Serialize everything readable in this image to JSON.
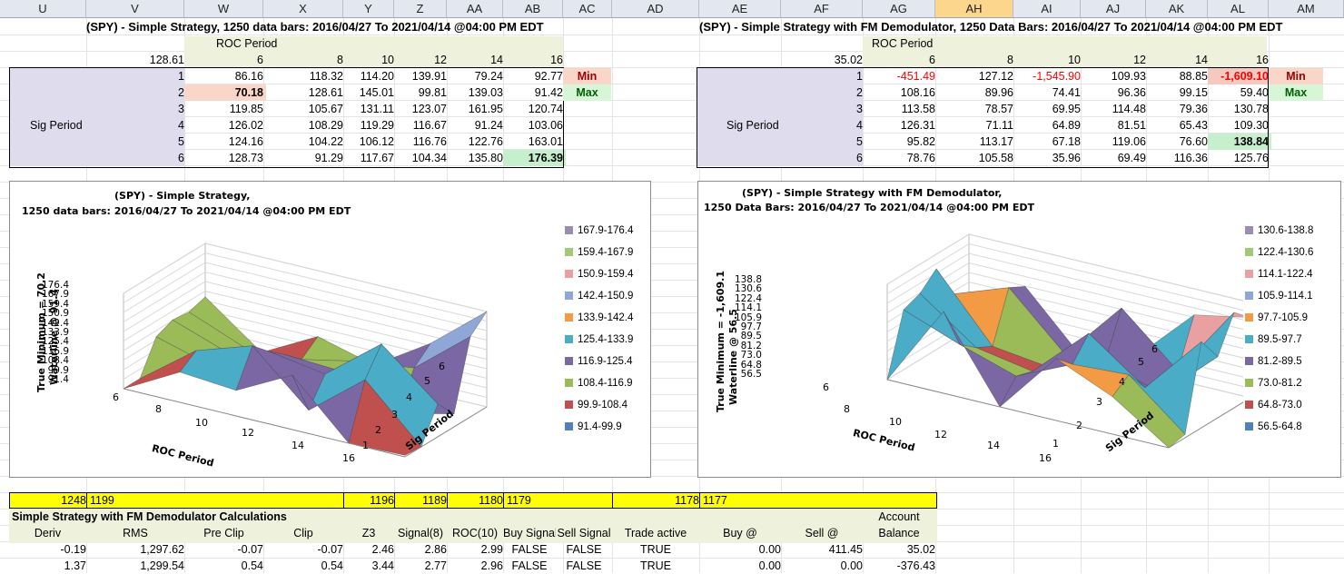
{
  "columns": [
    "U",
    "V",
    "W",
    "X",
    "Y",
    "Z",
    "AA",
    "AB",
    "AC",
    "AD",
    "AE",
    "AF",
    "AG",
    "AH",
    "AI",
    "AJ",
    "AK",
    "AL",
    "AM"
  ],
  "left_table": {
    "title": "(SPY) - Simple Strategy, 1250 data bars:  2016/04/27 To 2021/04/14 @04:00 PM EDT",
    "roc_label": "ROC Period",
    "corner_value": "128.61",
    "roc_periods": [
      "6",
      "8",
      "10",
      "12",
      "14",
      "16"
    ],
    "sig_label": "Sig Period",
    "sig_periods": [
      "1",
      "2",
      "3",
      "4",
      "5",
      "6"
    ],
    "rows": [
      [
        "86.16",
        "118.32",
        "114.20",
        "139.91",
        "79.24",
        "92.77"
      ],
      [
        "70.18",
        "128.61",
        "145.01",
        "99.81",
        "139.03",
        "91.42"
      ],
      [
        "119.85",
        "105.67",
        "131.11",
        "123.07",
        "161.95",
        "120.74"
      ],
      [
        "126.02",
        "108.29",
        "119.29",
        "116.67",
        "91.24",
        "103.06"
      ],
      [
        "124.16",
        "104.22",
        "106.12",
        "116.76",
        "122.76",
        "163.01"
      ],
      [
        "128.73",
        "91.29",
        "117.67",
        "104.34",
        "135.80",
        "176.39"
      ]
    ],
    "min_label": "Min",
    "max_label": "Max"
  },
  "right_table": {
    "title": "(SPY) - Simple Strategy with FM Demodulator, 1250 Data Bars:  2016/04/27 To 2021/04/14 @04:00 PM EDT",
    "roc_label": "ROC Period",
    "corner_value": "35.02",
    "roc_periods": [
      "6",
      "8",
      "10",
      "12",
      "14",
      "16"
    ],
    "sig_label": "Sig Period",
    "sig_periods": [
      "1",
      "2",
      "3",
      "4",
      "5",
      "6"
    ],
    "rows": [
      [
        "-451.49",
        "127.12",
        "-1,545.90",
        "109.93",
        "88.85",
        "-1,609.10"
      ],
      [
        "108.16",
        "89.96",
        "74.41",
        "96.36",
        "99.15",
        "59.40"
      ],
      [
        "113.58",
        "78.57",
        "69.95",
        "114.48",
        "79.36",
        "130.78"
      ],
      [
        "126.31",
        "71.11",
        "64.89",
        "81.51",
        "65.43",
        "109.30"
      ],
      [
        "95.82",
        "113.17",
        "67.18",
        "119.06",
        "76.60",
        "138.84"
      ],
      [
        "78.76",
        "105.58",
        "35.96",
        "69.49",
        "116.36",
        "125.76"
      ]
    ],
    "min_label": "Min",
    "max_label": "Max"
  },
  "left_chart": {
    "title_line1": "(SPY) - Simple Strategy,",
    "title_line2": "1250 data bars:  2016/04/27 To 2021/04/14 @04:00 PM EDT",
    "zlabel_line1": "True Minimum = 70.2",
    "zlabel_line2": "Waterline @ 91.4",
    "xlabel": "ROC Period",
    "ylabel": "Sig Period",
    "z_ticks": [
      "176.4",
      "167.9",
      "159.4",
      "150.9",
      "142.4",
      "133.9",
      "125.4",
      "116.9",
      "108.4",
      "99.9",
      "91.4"
    ],
    "x_ticks": [
      "6",
      "8",
      "10",
      "12",
      "14",
      "16"
    ],
    "y_ticks": [
      "1",
      "2",
      "3",
      "4",
      "5",
      "6"
    ],
    "legend": [
      "167.9-176.4",
      "159.4-167.9",
      "150.9-159.4",
      "142.4-150.9",
      "133.9-142.4",
      "125.4-133.9",
      "116.9-125.4",
      "108.4-116.9",
      "99.9-108.4",
      "91.4-99.9"
    ]
  },
  "right_chart": {
    "title_line1": "(SPY) - Simple Strategy with FM Demodulator,",
    "title_line2": "1250 Data Bars:  2016/04/27 To 2021/04/14 @04:00 PM EDT",
    "zlabel_line1": "True Minimum = -1,609.1",
    "zlabel_line2": "Waterline @ 56.5",
    "xlabel": "ROC Period",
    "ylabel": "Sig Period",
    "z_ticks": [
      "138.8",
      "130.6",
      "122.4",
      "114.1",
      "105.9",
      "97.7",
      "89.5",
      "81.2",
      "73.0",
      "64.8",
      "56.5"
    ],
    "x_ticks": [
      "6",
      "8",
      "10",
      "12",
      "14",
      "16"
    ],
    "y_ticks": [
      "1",
      "2",
      "3",
      "4",
      "5",
      "6"
    ],
    "legend": [
      "130.6-138.8",
      "122.4-130.6",
      "114.1-122.4",
      "105.9-114.1",
      "97.7-105.9",
      "89.5-97.7",
      "81.2-89.5",
      "73.0-81.2",
      "64.8-73.0",
      "56.5-64.8"
    ]
  },
  "legend_colors": [
    "#9b8bb5",
    "#a4c87a",
    "#e8a0a0",
    "#8fa7d6",
    "#f39a45",
    "#4aacc6",
    "#7c67a5",
    "#9bbb59",
    "#c0504d",
    "#4f81bd"
  ],
  "yellow_row": [
    "1248",
    "1199",
    "1196",
    "1189",
    "1180",
    "1179",
    "1178",
    "1177"
  ],
  "calc": {
    "title": "Simple Strategy with FM Demodulator Calculations",
    "headers": [
      "Deriv",
      "RMS",
      "Pre Clip",
      "Clip",
      "Z3",
      "Signal(8)",
      "ROC(10)",
      "Buy Signal",
      "Sell Signal",
      "Trade active",
      "Buy @",
      "Sell @",
      "Account",
      "Balance"
    ],
    "rows": [
      [
        "-0.19",
        "1,297.62",
        "-0.07",
        "-0.07",
        "2.46",
        "2.86",
        "2.99",
        "FALSE",
        "FALSE",
        "TRUE",
        "0.00",
        "411.45",
        "35.02"
      ],
      [
        "1.37",
        "1,299.54",
        "0.54",
        "0.54",
        "3.44",
        "2.77",
        "2.96",
        "FALSE",
        "FALSE",
        "TRUE",
        "0.00",
        "0.00",
        "-376.43"
      ]
    ]
  }
}
